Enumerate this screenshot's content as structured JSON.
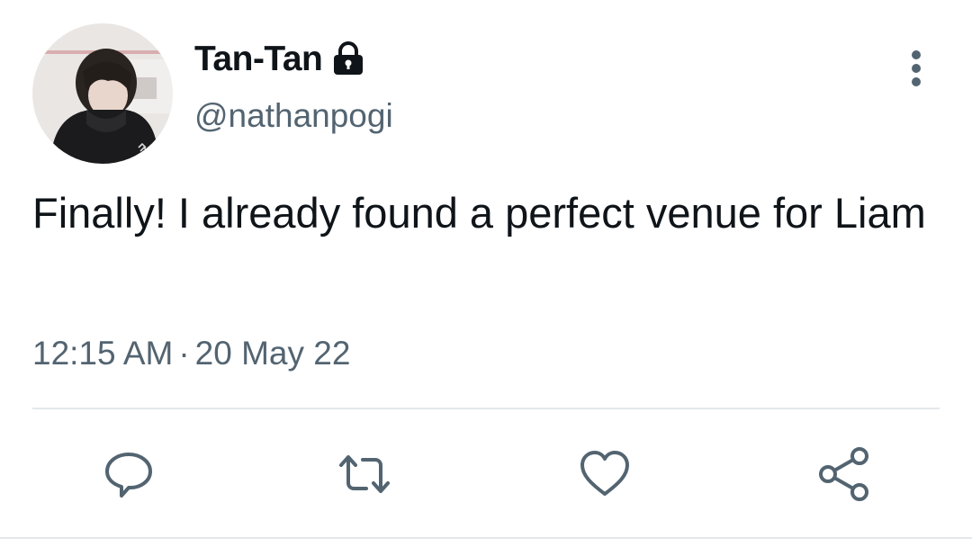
{
  "user": {
    "display_name": "Tan-Tan",
    "handle": "@nathanpogi",
    "avatar_icon": "profile-photo",
    "protected_icon": "lock-icon"
  },
  "tweet": {
    "text": "Finally! I already found a perfect venue for Liam",
    "time": "12:15 AM",
    "separator": "·",
    "date": "20 May 22"
  },
  "actions": [
    {
      "name": "reply",
      "icon": "reply-icon"
    },
    {
      "name": "retweet",
      "icon": "retweet-icon"
    },
    {
      "name": "like",
      "icon": "heart-icon"
    },
    {
      "name": "share",
      "icon": "share-icon"
    }
  ],
  "colors": {
    "text_primary": "#0f1419",
    "text_secondary": "#536471",
    "divider": "#e4e8eb"
  }
}
